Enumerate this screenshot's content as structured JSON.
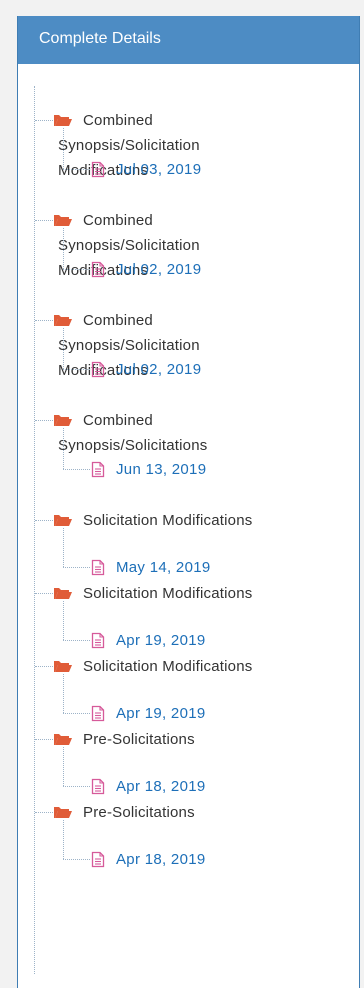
{
  "panel": {
    "title": "Complete Details"
  },
  "colors": {
    "header_bg": "#4d8cc4",
    "folder_icon": "#e05c38",
    "document_icon": "#d65a9a",
    "date_text": "#1d6fb8",
    "label_text": "#333333"
  },
  "icons": {
    "folder": "folder-open-icon",
    "document": "document-icon"
  },
  "tree": [
    {
      "label_lines": [
        "Combined",
        "Synopsis/Solicitation",
        "Modifications"
      ],
      "date": "Jul 03, 2019"
    },
    {
      "label_lines": [
        "Combined",
        "Synopsis/Solicitation",
        "Modifications"
      ],
      "date": "Jul 02, 2019"
    },
    {
      "label_lines": [
        "Combined",
        "Synopsis/Solicitation",
        "Modifications"
      ],
      "date": "Jul 02, 2019"
    },
    {
      "label_lines": [
        "Combined",
        "Synopsis/Solicitations"
      ],
      "date": "Jun 13, 2019"
    },
    {
      "label_lines": [
        "Solicitation Modifications"
      ],
      "date": "May 14, 2019"
    },
    {
      "label_lines": [
        "Solicitation Modifications"
      ],
      "date": "Apr 19, 2019"
    },
    {
      "label_lines": [
        "Solicitation Modifications"
      ],
      "date": "Apr 19, 2019"
    },
    {
      "label_lines": [
        "Pre-Solicitations"
      ],
      "date": "Apr 18, 2019"
    },
    {
      "label_lines": [
        "Pre-Solicitations"
      ],
      "date": "Apr 18, 2019"
    }
  ]
}
